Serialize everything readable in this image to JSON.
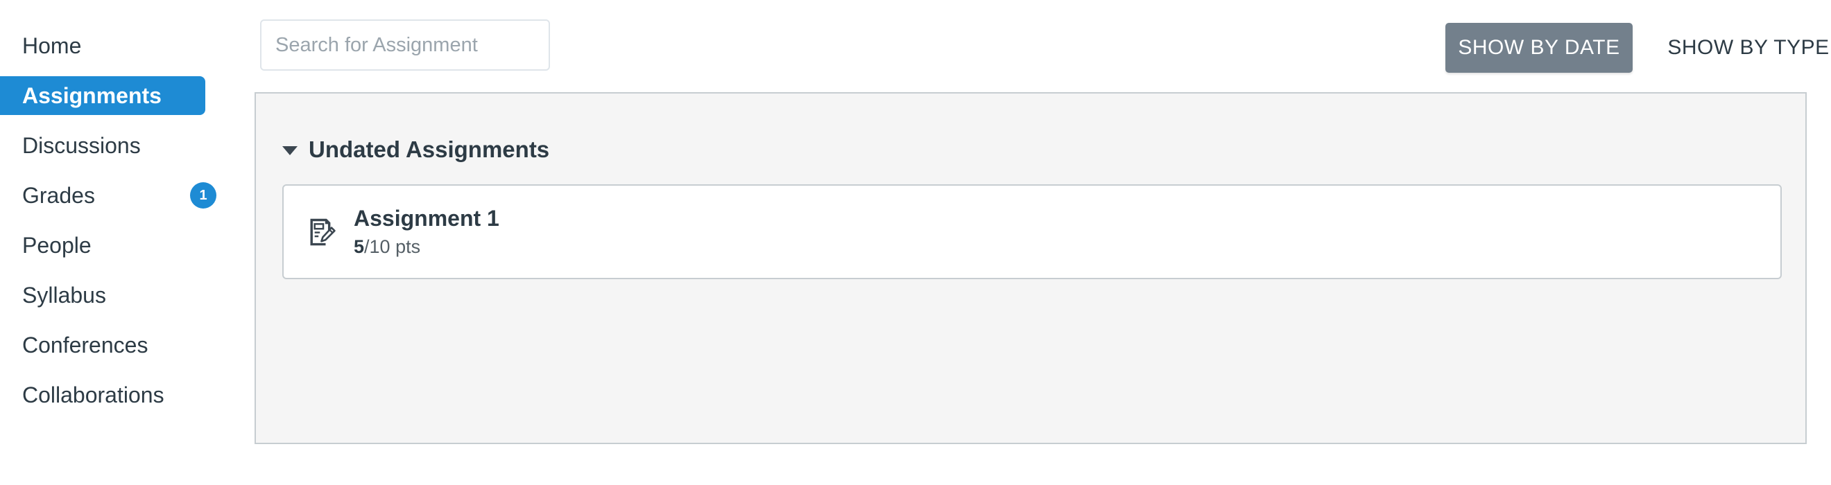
{
  "sidebar": {
    "items": [
      {
        "label": "Home",
        "active": false,
        "badge": null
      },
      {
        "label": "Assignments",
        "active": true,
        "badge": null
      },
      {
        "label": "Discussions",
        "active": false,
        "badge": null
      },
      {
        "label": "Grades",
        "active": false,
        "badge": "1"
      },
      {
        "label": "People",
        "active": false,
        "badge": null
      },
      {
        "label": "Syllabus",
        "active": false,
        "badge": null
      },
      {
        "label": "Conferences",
        "active": false,
        "badge": null
      },
      {
        "label": "Collaborations",
        "active": false,
        "badge": null
      }
    ]
  },
  "toolbar": {
    "search": {
      "value": "",
      "placeholder": "Search for Assignment",
      "icon": "search-input"
    },
    "show_by_date_label": "SHOW BY DATE",
    "show_by_type_label": "SHOW BY TYPE",
    "active_view": "SHOW BY DATE"
  },
  "main": {
    "group": {
      "title": "Undated Assignments",
      "collapse_icon": "caret-down-icon",
      "expanded": true
    },
    "assignments": [
      {
        "icon": "assignment-document-pencil-icon",
        "title": "Assignment 1",
        "score": "5",
        "points_suffix": "/10 pts"
      }
    ]
  },
  "colors": {
    "accent_blue": "#1e8bd4",
    "toggle_active_grey": "#73808c",
    "panel_background": "#f5f5f5",
    "panel_border": "#c7cdd1",
    "text_primary": "#2d3b45",
    "placeholder_grey": "#9ba5ad"
  }
}
